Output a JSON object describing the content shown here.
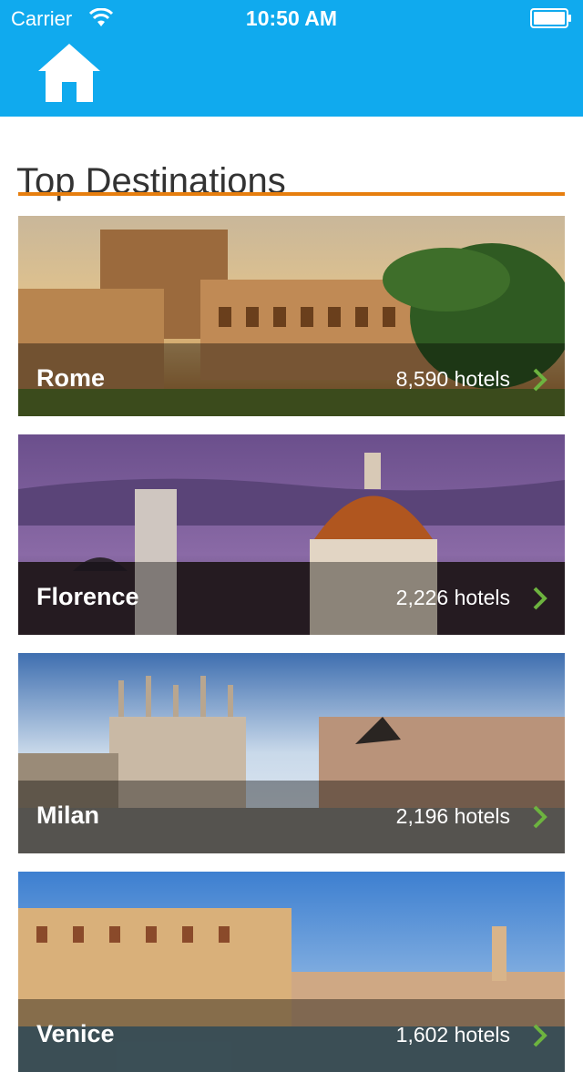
{
  "status_bar": {
    "carrier": "Carrier",
    "time": "10:50 AM"
  },
  "header": {
    "home_icon": "home-icon",
    "color": "#10aaee"
  },
  "section": {
    "title": "Top Destinations",
    "accent": "#e67e0e"
  },
  "destinations": [
    {
      "name": "Rome",
      "hotels": "8,590 hotels"
    },
    {
      "name": "Florence",
      "hotels": "2,226 hotels"
    },
    {
      "name": "Milan",
      "hotels": "2,196 hotels"
    },
    {
      "name": "Venice",
      "hotels": "1,602 hotels"
    }
  ],
  "chevron_color": "#6db33f"
}
